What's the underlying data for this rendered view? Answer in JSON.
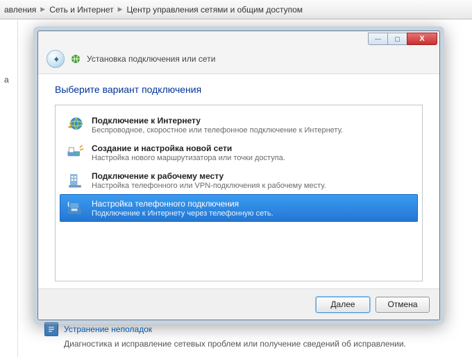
{
  "breadcrumb": {
    "item1": "авления",
    "item2": "Сеть и Интернет",
    "item3": "Центр управления сетями и общим доступом"
  },
  "bg": {
    "side_letter": "а",
    "troubleshoot_link": "Устранение неполадок",
    "troubleshoot_desc": "Диагностика и исправление сетевых проблем или получение сведений об исправлении."
  },
  "dialog": {
    "header_text": "Установка подключения или сети",
    "heading": "Выберите вариант подключения",
    "options": [
      {
        "title": "Подключение к Интернету",
        "desc": "Беспроводное, скоростное или телефонное подключение к Интернету."
      },
      {
        "title": "Создание и настройка новой сети",
        "desc": "Настройка нового маршрутизатора или точки доступа."
      },
      {
        "title": "Подключение к рабочему месту",
        "desc": "Настройка телефонного или VPN-подключения к рабочему месту."
      },
      {
        "title": "Настройка телефонного подключения",
        "desc": "Подключение к Интернету через телефонную сеть."
      }
    ],
    "next": "Далее",
    "cancel": "Отмена"
  }
}
